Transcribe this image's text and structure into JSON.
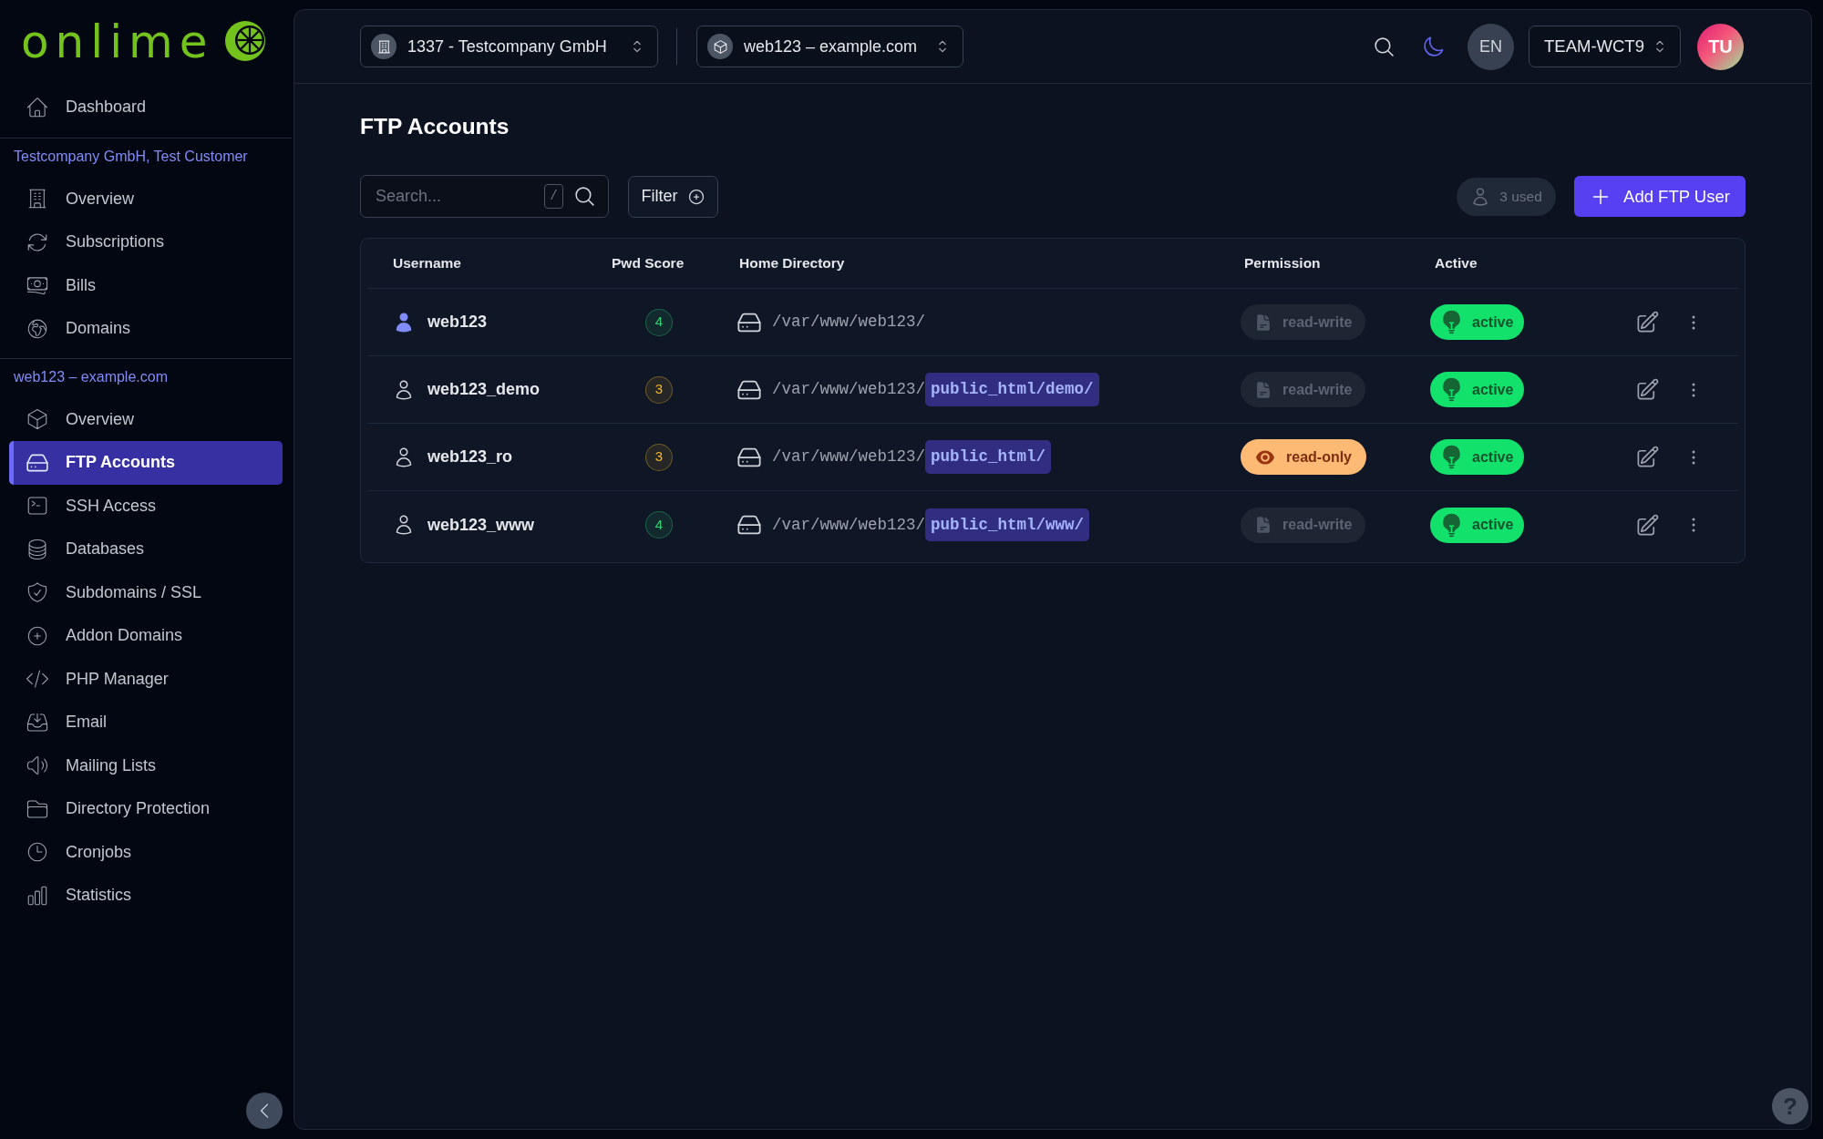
{
  "logo": {
    "wordmark": "onlime"
  },
  "sidebar": {
    "top_items": [
      {
        "label": "Dashboard",
        "selected": false
      }
    ],
    "sections": [
      {
        "title": "Testcompany GmbH, Test Customer",
        "items": [
          {
            "label": "Overview",
            "selected": false
          },
          {
            "label": "Subscriptions",
            "selected": false
          },
          {
            "label": "Bills",
            "selected": false
          },
          {
            "label": "Domains",
            "selected": false
          }
        ]
      },
      {
        "title": "web123 – example.com",
        "items": [
          {
            "label": "Overview",
            "selected": false
          },
          {
            "label": "FTP Accounts",
            "selected": true
          },
          {
            "label": "SSH Access",
            "selected": false
          },
          {
            "label": "Databases",
            "selected": false
          },
          {
            "label": "Subdomains / SSL",
            "selected": false
          },
          {
            "label": "Addon Domains",
            "selected": false
          },
          {
            "label": "PHP Manager",
            "selected": false
          },
          {
            "label": "Email",
            "selected": false
          },
          {
            "label": "Mailing Lists",
            "selected": false
          },
          {
            "label": "Directory Protection",
            "selected": false
          },
          {
            "label": "Cronjobs",
            "selected": false
          },
          {
            "label": "Statistics",
            "selected": false
          }
        ]
      }
    ]
  },
  "topbar": {
    "account_selector": "1337 - Testcompany GmbH",
    "site_selector": "web123 – example.com",
    "language": "EN",
    "team_selector": "TEAM-WCT9",
    "avatar_initials": "TU"
  },
  "page": {
    "title": "FTP Accounts",
    "search": {
      "placeholder": "Search...",
      "shortcut": "/"
    },
    "filter_button": "Filter",
    "usage": "3 used",
    "add_button": "Add FTP User",
    "table": {
      "columns": [
        "Username",
        "Pwd Score",
        "Home Directory",
        "Permission",
        "Active"
      ],
      "rows": [
        {
          "username": "web123",
          "primary": true,
          "pwd_score": {
            "value": "4",
            "color": "#2fd47a"
          },
          "home_directory": {
            "base": "/var/www/web123/"
          },
          "permission": {
            "label": "read-write",
            "kind": "readwrite"
          },
          "active": {
            "label": "active",
            "on": true
          }
        },
        {
          "username": "web123_demo",
          "primary": false,
          "pwd_score": {
            "value": "3",
            "color": "#f5b829"
          },
          "home_directory": {
            "base": "/var/www/web123/",
            "subpath": "public_html/demo/"
          },
          "permission": {
            "label": "read-write",
            "kind": "readwrite"
          },
          "active": {
            "label": "active",
            "on": true
          }
        },
        {
          "username": "web123_ro",
          "primary": false,
          "pwd_score": {
            "value": "3",
            "color": "#f5b829"
          },
          "home_directory": {
            "base": "/var/www/web123/",
            "subpath": "public_html/"
          },
          "permission": {
            "label": "read-only",
            "kind": "readonly"
          },
          "active": {
            "label": "active",
            "on": true
          }
        },
        {
          "username": "web123_www",
          "primary": false,
          "pwd_score": {
            "value": "4",
            "color": "#2fd47a"
          },
          "home_directory": {
            "base": "/var/www/web123/",
            "subpath": "public_html/www/"
          },
          "permission": {
            "label": "read-write",
            "kind": "readwrite"
          },
          "active": {
            "label": "active",
            "on": true
          }
        }
      ]
    }
  },
  "help_button": "?"
}
